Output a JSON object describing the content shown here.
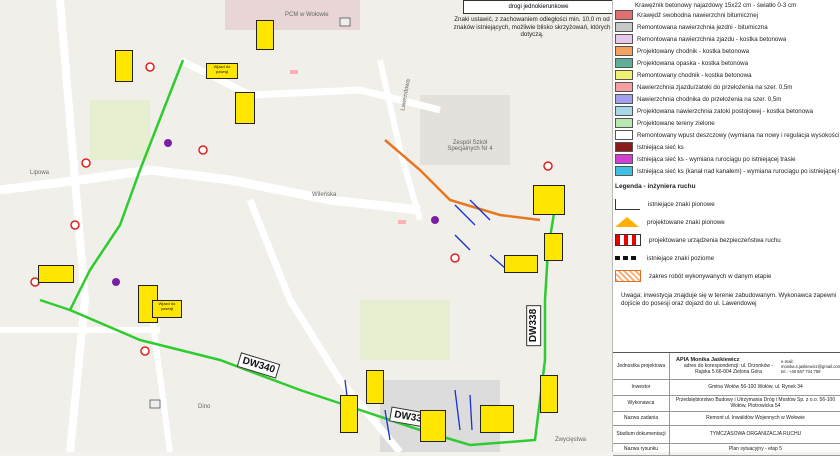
{
  "map": {
    "road_labels": [
      "DW340",
      "DW338",
      "DW338"
    ],
    "place_labels": [
      "PCM w Wołowie",
      "Zespół Szkół Specjalnych Nr 4",
      "Lipowa",
      "Wileńska",
      "Lawendowa",
      "Zwycięstwa",
      "Dino"
    ],
    "top_note": "Znaki ustawić, z zachowaniem odległości min. 10,0 m od znaków istniejących, możliwie blisko skrzyżowań, których dotyczą.",
    "top_box_label": "drogi jednokierunkowe",
    "sign_text": "Wjazd do posesji",
    "colors": {
      "route": "#2ecc2e",
      "orange_path": "#e87722",
      "blue_arrows": "#1a2fd6",
      "sign_yellow": "#ffe600"
    }
  },
  "legend": {
    "top_item": "Krawężnik betonowy najazdowy 15x22 cm - światło 0-3 cm",
    "items": [
      {
        "label": "Krawędź swobodna nawierzchni bitumicznej",
        "color": "#e07070"
      },
      {
        "label": "Remontowana nawierzchnia jezdni - bitumiczna",
        "color": "#c8c8c8"
      },
      {
        "label": "Remontowana nawierzchnia zjazdu - kostka betonowa",
        "color": "#e8c8e8"
      },
      {
        "label": "Projektowany chodnik - kostka betonowa",
        "color": "#f4a460"
      },
      {
        "label": "Projektowana opaska - kostka betonowa",
        "color": "#5fae9a"
      },
      {
        "label": "Remontowany chodnik - kostka betonowa",
        "color": "#f0f070"
      },
      {
        "label": "Nawierzchnia zjazdu/zatoki do przełożenia na szer. 0,5m",
        "color": "#f4a0a0"
      },
      {
        "label": "Nawierzchnia chodnika do przełożenia na szer. 0,5m",
        "color": "#a0a0f0"
      },
      {
        "label": "Projektowana nawierzchnia zatoki postojowej - kostka betonowa",
        "color": "#a8d8e8"
      },
      {
        "label": "Projektowane tereny zielone",
        "color": "#b8e8b0"
      },
      {
        "label": "Remontowany wpust deszczowy (wymiana na nowy i regulacja wysokościowa)",
        "color": "#ffffff"
      },
      {
        "label": "Istniejąca sieć ks",
        "color": "#8b1a1a"
      },
      {
        "label": "Istniejąca sieć ks - wymiana rurociągu po istniejącej trasie",
        "color": "#d040d0"
      },
      {
        "label": "Istniejąca sieć ks (kanał nad kanałem) - wymiana rurociągu po istniejącej trasie",
        "color": "#40c0e0"
      }
    ],
    "traffic_title": "Legenda - inżyniera ruchu",
    "traffic_items": [
      "istniejące znaki pionowe",
      "projektowane znaki pionowe",
      "projektowane urządzenia bezpieczeństwa ruchu",
      "istniejące znaki poziome",
      "zakres robót wykonywanych w danym etapie"
    ],
    "warning": "Uwaga: inwestycja znajduje się w terenie zabudowanym. Wykonawca zapewni dojście do posesji oraz dojazd do ul. Lawendowej"
  },
  "stamp": {
    "unit_label": "Jednostka projektowa",
    "unit_value": "APIA Monika Jaśkiewicz",
    "unit_addr": "adres do korespondencji: ul. Drzonków - Rajska 5 66-004 Zielona Góra",
    "contact": "e-mail: monika.s.jaskiewicz@gmail.com tel.: +48 667 734 759",
    "investor_label": "Inwestor",
    "investor_value": "Gmina Wołów 56-100 Wołów, ul. Rynek 34",
    "contractor_label": "Wykonawca",
    "contractor_value": "Przedsiębiorstwo Budowy i Utrzymania Dróg i Mostów Sp. z o.o. 56-100 Wołów, Piotrowicka 54",
    "task_label": "Nazwa zadania",
    "task_value": "Remont ul. Inwalidów Wojennych w Wołowie",
    "stage_label": "Stadium dokumentacji",
    "stage_value": "TYMCZASOWA ORGANIZACJA RUCHU",
    "drawing_label": "Nazwa rysunku",
    "drawing_value": "Plan sytuacyjny - etap 5"
  }
}
